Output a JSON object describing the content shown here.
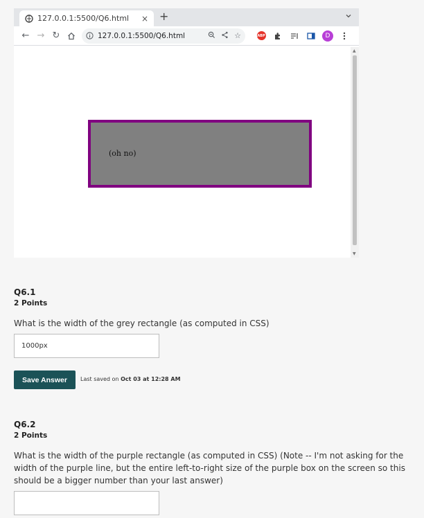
{
  "browser": {
    "tab_title": "127.0.0.1:5500/Q6.html",
    "tab_close": "×",
    "new_tab": "+",
    "url": "127.0.0.1:5500/Q6.html",
    "abp_label": "ABP",
    "profile_initial": "D"
  },
  "page": {
    "box_text": "(oh no)"
  },
  "colors": {
    "purple_border": "#800080",
    "grey_fill": "#808080",
    "button_bg": "#1b5257"
  },
  "q1": {
    "title": "Q6.1",
    "points": "2 Points",
    "question": "What is the width of the grey rectangle (as computed in CSS)",
    "answer": "1000px",
    "save_label": "Save Answer",
    "saved_prefix": "Last saved on",
    "saved_time": "Oct 03 at 12:28 AM"
  },
  "q2": {
    "title": "Q6.2",
    "points": "2 Points",
    "question": "What is the width of the purple rectangle (as computed in CSS) (Note -- I'm not asking for the width of the purple line, but the entire left-to-right size of the purple box on the screen so this should be a bigger number than your last answer)",
    "answer": ""
  }
}
